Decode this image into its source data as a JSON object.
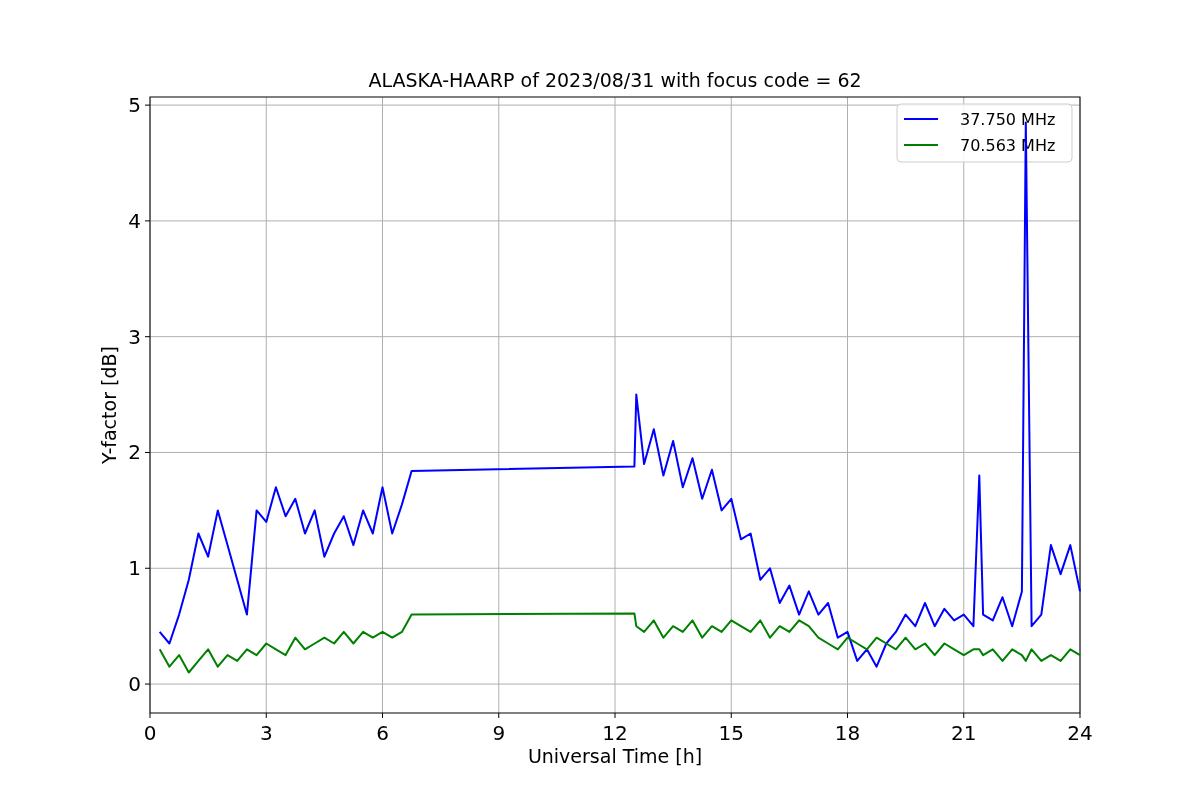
{
  "figure": {
    "chart_data": {
      "type": "line",
      "title": "ALASKA-HAARP of 2023/08/31 with focus code = 62",
      "xlabel": "Universal Time [h]",
      "ylabel": "Y-factor [dB]",
      "xlim": [
        0,
        24
      ],
      "ylim": [
        -0.25,
        5.07
      ],
      "xticks": [
        0,
        3,
        6,
        9,
        12,
        15,
        18,
        21,
        24
      ],
      "yticks": [
        0,
        1,
        2,
        3,
        4,
        5
      ],
      "grid": true,
      "legend": true,
      "x": [
        0.25,
        0.5,
        0.75,
        1,
        1.25,
        1.5,
        1.75,
        2,
        2.25,
        2.5,
        2.75,
        3,
        3.25,
        3.5,
        3.75,
        4,
        4.25,
        4.5,
        4.75,
        5,
        5.25,
        5.5,
        5.75,
        6,
        6.25,
        6.5,
        6.75,
        12.5,
        12.55,
        12.75,
        13,
        13.25,
        13.5,
        13.75,
        14,
        14.25,
        14.5,
        14.75,
        15,
        15.25,
        15.5,
        15.75,
        16,
        16.25,
        16.5,
        16.75,
        17,
        17.25,
        17.5,
        17.75,
        18,
        18.25,
        18.5,
        18.75,
        19,
        19.25,
        19.5,
        19.75,
        20,
        20.25,
        20.5,
        20.75,
        21,
        21.25,
        21.4,
        21.5,
        21.75,
        22,
        22.25,
        22.5,
        22.6,
        22.75,
        23,
        23.25,
        23.5,
        23.75,
        24
      ],
      "series": [
        {
          "name": "37.750 MHz",
          "color": "#0000ff",
          "values": [
            0.45,
            0.35,
            0.6,
            0.9,
            1.3,
            1.1,
            1.5,
            1.2,
            0.9,
            0.6,
            1.5,
            1.4,
            1.7,
            1.45,
            1.6,
            1.3,
            1.5,
            1.1,
            1.3,
            1.45,
            1.2,
            1.5,
            1.3,
            1.7,
            1.3,
            1.55,
            1.84,
            1.88,
            2.5,
            1.9,
            2.2,
            1.8,
            2.1,
            1.7,
            1.95,
            1.6,
            1.85,
            1.5,
            1.6,
            1.25,
            1.3,
            0.9,
            1.0,
            0.7,
            0.85,
            0.6,
            0.8,
            0.6,
            0.7,
            0.4,
            0.45,
            0.2,
            0.3,
            0.15,
            0.35,
            0.45,
            0.6,
            0.5,
            0.7,
            0.5,
            0.65,
            0.55,
            0.6,
            0.5,
            1.8,
            0.6,
            0.55,
            0.75,
            0.5,
            0.8,
            4.85,
            0.5,
            0.6,
            1.2,
            0.95,
            1.2,
            0.8
          ]
        },
        {
          "name": "70.563 MHz",
          "color": "#008000",
          "values": [
            0.3,
            0.15,
            0.25,
            0.1,
            0.2,
            0.3,
            0.15,
            0.25,
            0.2,
            0.3,
            0.25,
            0.35,
            0.3,
            0.25,
            0.4,
            0.3,
            0.35,
            0.4,
            0.35,
            0.45,
            0.35,
            0.45,
            0.4,
            0.45,
            0.4,
            0.45,
            0.6,
            0.61,
            0.5,
            0.45,
            0.55,
            0.4,
            0.5,
            0.45,
            0.55,
            0.4,
            0.5,
            0.45,
            0.55,
            0.5,
            0.45,
            0.55,
            0.4,
            0.5,
            0.45,
            0.55,
            0.5,
            0.4,
            0.35,
            0.3,
            0.4,
            0.35,
            0.3,
            0.4,
            0.35,
            0.3,
            0.4,
            0.3,
            0.35,
            0.25,
            0.35,
            0.3,
            0.25,
            0.3,
            0.3,
            0.25,
            0.3,
            0.2,
            0.3,
            0.25,
            0.2,
            0.3,
            0.2,
            0.25,
            0.2,
            0.3,
            0.25
          ]
        }
      ]
    }
  }
}
